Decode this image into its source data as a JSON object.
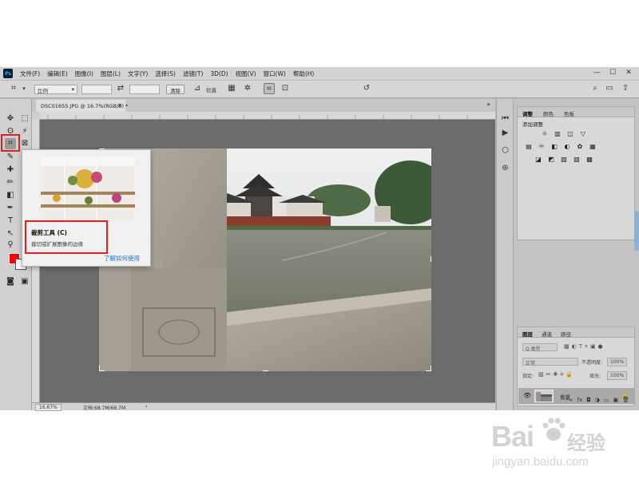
{
  "app": {
    "logo_text": "Ps",
    "menu": [
      "文件(F)",
      "编辑(E)",
      "图像(I)",
      "图层(L)",
      "文字(Y)",
      "选择(S)",
      "滤镜(T)",
      "3D(D)",
      "视图(V)",
      "窗口(W)",
      "帮助(H)"
    ],
    "window_controls": {
      "minimize": "—",
      "maximize": "☐",
      "close": "✕"
    }
  },
  "options_bar": {
    "ratio_select": "比例",
    "clear_button": "清除",
    "straighten_label": "拉直"
  },
  "document": {
    "tab_title": "DSC01655.JPG @ 16.7%(RGB/8) *",
    "tab_close": "×",
    "zoom": "16.67%",
    "doc_info": "文档:68.7M/68.7M",
    "status_arrow": "›"
  },
  "tooltip": {
    "title": "裁剪工具 (C)",
    "description": "裁切或扩展图像的边缘",
    "link": "了解如何使用"
  },
  "panels": {
    "adjustments": {
      "tabs": [
        "调整",
        "颜色",
        "色板"
      ],
      "add_label": "添加调整",
      "icons_row1": [
        "☼",
        "▥",
        "◫",
        "▽"
      ],
      "icons_row2": [
        "▤",
        "♾",
        "◧",
        "◐",
        "✿",
        "▦"
      ],
      "icons_row3": [
        "◪",
        "◩",
        "▨",
        "▧",
        "▩"
      ]
    },
    "layers": {
      "tabs": [
        "图层",
        "通道",
        "路径"
      ],
      "search_kind": "Q 类型",
      "blend_mode": "正常",
      "opacity_label": "不透明度:",
      "opacity_value": "100%",
      "lock_label": "锁定:",
      "fill_label": "填充:",
      "fill_value": "100%",
      "layer_name": "背景",
      "footer_icons": [
        "∞",
        "fx",
        "◘",
        "◑",
        "▭",
        "▣",
        "🗑"
      ]
    }
  },
  "watermark": {
    "brand": "Bai",
    "brand_cn": "经验",
    "url": "jingyan.baidu.com"
  },
  "colors": {
    "foreground": "#ff0000",
    "background": "#ffffff",
    "highlight_box": "#e02020",
    "link": "#1473e6"
  }
}
